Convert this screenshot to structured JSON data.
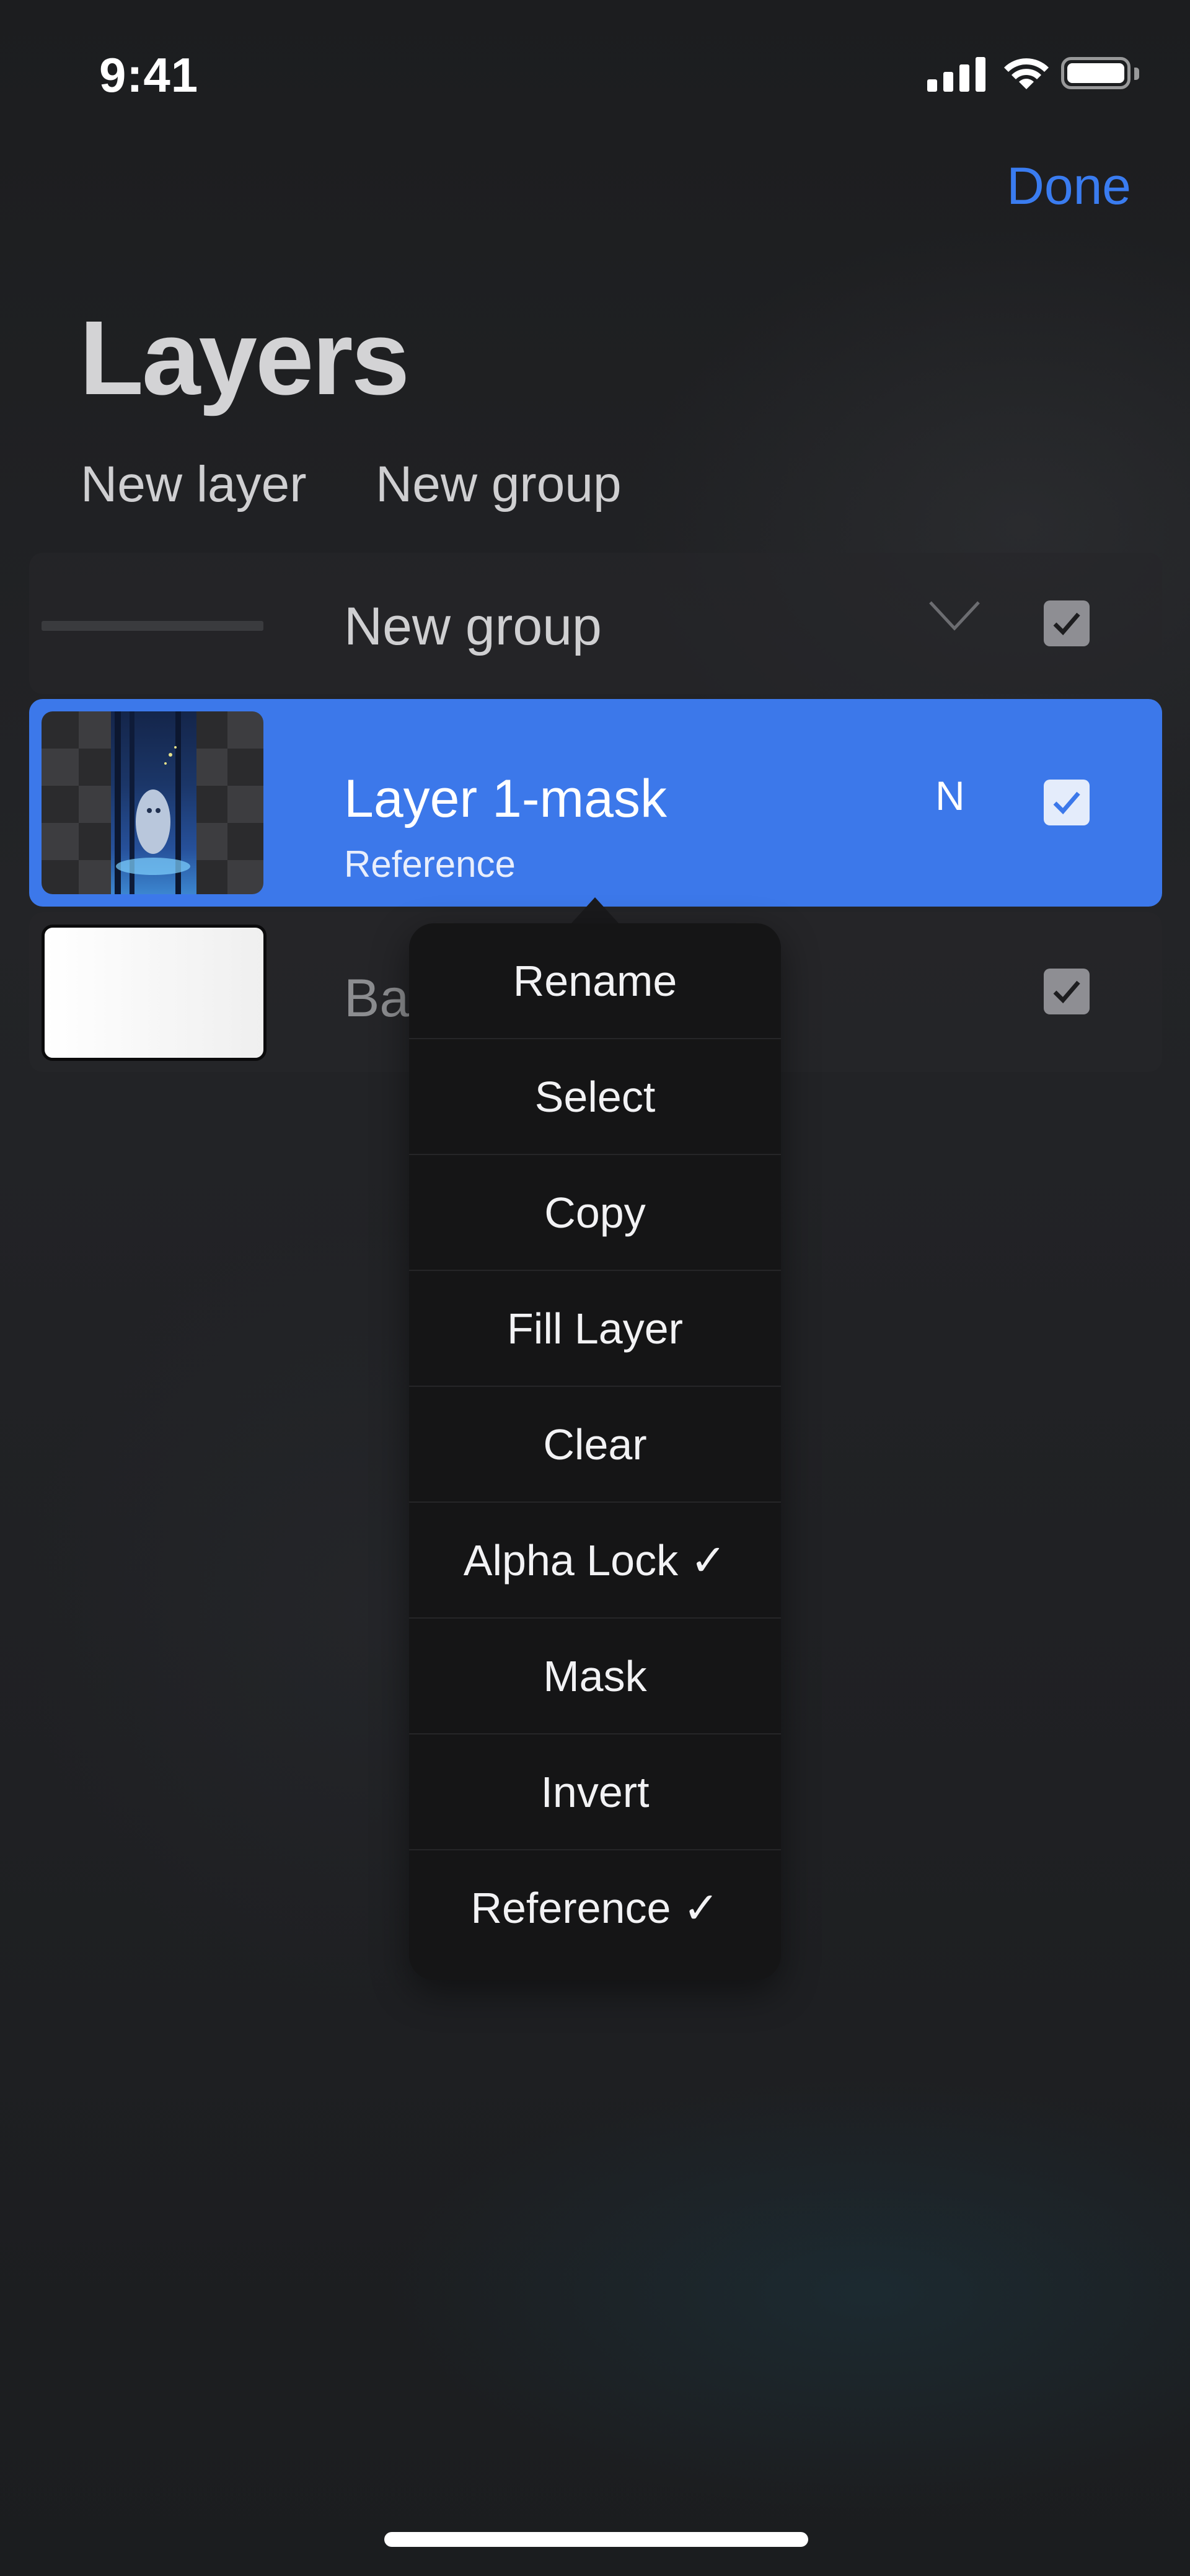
{
  "status_bar": {
    "time": "9:41"
  },
  "header": {
    "done_label": "Done",
    "title": "Layers",
    "new_layer_label": "New layer",
    "new_group_label": "New group"
  },
  "layers": {
    "group_row": {
      "name": "New group",
      "visible": true,
      "collapsed_icon": "chevron-down-icon"
    },
    "selected_row": {
      "name": "Layer 1-mask",
      "subtitle": "Reference",
      "blend_mode": "N",
      "visible": true
    },
    "background_row": {
      "name": "Background color",
      "visible": true
    }
  },
  "context_menu": {
    "items": [
      "Rename",
      "Select",
      "Copy",
      "Fill Layer",
      "Clear",
      "Alpha Lock ✓",
      "Mask",
      "Invert",
      "Reference ✓"
    ]
  },
  "colors": {
    "accent": "#3a7cf0",
    "selected_row": "#3c78ea",
    "menu_bg": "#151516"
  }
}
